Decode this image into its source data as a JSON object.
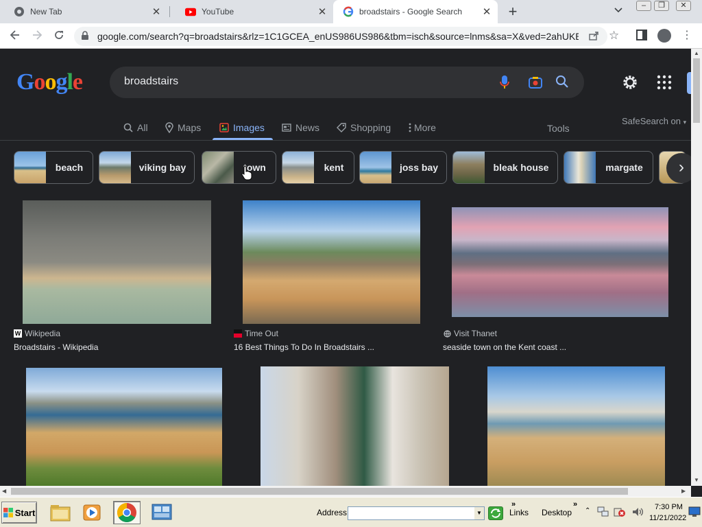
{
  "browser": {
    "tabs": [
      {
        "title": "New Tab",
        "favicon": "chrome-icon"
      },
      {
        "title": "YouTube",
        "favicon": "youtube-icon"
      },
      {
        "title": "broadstairs - Google Search",
        "favicon": "google-g-icon",
        "active": true
      }
    ],
    "new_tab_label": "+",
    "url": "google.com/search?q=broadstairs&rlz=1C1GCEA_enUS986US986&tbm=isch&source=lnms&sa=X&ved=2ahUKE..."
  },
  "google": {
    "logo_letters": [
      "G",
      "o",
      "o",
      "g",
      "l",
      "e"
    ],
    "search_query": "broadstairs",
    "nav_tabs": [
      {
        "label": "All",
        "icon": "search-icon"
      },
      {
        "label": "Maps",
        "icon": "map-pin-icon"
      },
      {
        "label": "Images",
        "icon": "image-icon",
        "active": true
      },
      {
        "label": "News",
        "icon": "news-icon"
      },
      {
        "label": "Shopping",
        "icon": "tag-icon"
      },
      {
        "label": "More",
        "icon": "more-vert-icon"
      }
    ],
    "tools_label": "Tools",
    "safesearch_label": "SafeSearch on",
    "chips": [
      "beach",
      "viking bay",
      "town",
      "kent",
      "joss bay",
      "bleak house",
      "margate"
    ],
    "results": [
      {
        "source": "Wikipedia",
        "title": "Broadstairs - Wikipedia",
        "source_icon": "wikipedia-icon"
      },
      {
        "source": "Time Out",
        "title": "16 Best Things To Do In Broadstairs ...",
        "source_icon": "timeout-icon"
      },
      {
        "source": "Visit Thanet",
        "title": "seaside town on the Kent coast ...",
        "source_icon": "globe-icon"
      },
      {
        "source": "",
        "title": ""
      },
      {
        "source": "",
        "title": ""
      },
      {
        "source": "",
        "title": ""
      }
    ]
  },
  "taskbar": {
    "start_label": "Start",
    "address_label": "Address",
    "address_value": "",
    "links_label": "Links",
    "desktop_label": "Desktop",
    "time": "7:30 PM",
    "date": "11/21/2022"
  },
  "colors": {
    "page_bg": "#202124",
    "accent_blue": "#8ab4f8",
    "text_primary": "#e8eaed",
    "text_secondary": "#9aa0a6"
  }
}
